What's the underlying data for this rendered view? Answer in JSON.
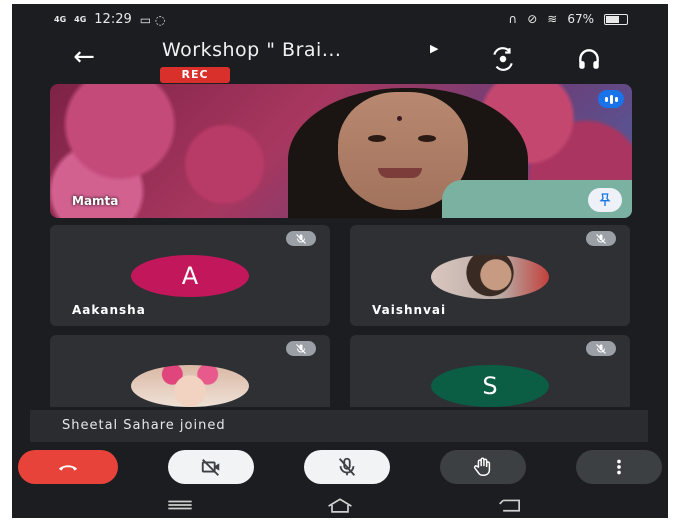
{
  "status_bar": {
    "network_left": "4G",
    "network_right": "4G",
    "time": "12:29",
    "battery": "67%"
  },
  "meeting": {
    "title": "Workshop \" Brai...",
    "recording_badge": "REC"
  },
  "main_participant": {
    "name": "Mamta"
  },
  "participants": [
    {
      "name": "Aakansha",
      "initial": "A",
      "avatar_color": "#c2185b",
      "muted": true
    },
    {
      "name": "Vaishnvai",
      "initial": "",
      "avatar_color": "",
      "muted": true
    },
    {
      "name": "",
      "initial": "",
      "avatar_color": "",
      "muted": true
    },
    {
      "name": "",
      "initial": "S",
      "avatar_color": "#0b5d43",
      "muted": true
    }
  ],
  "toast": {
    "text": "Sheetal Sahare joined"
  },
  "controls": {
    "end_call": "phone-end-icon",
    "camera": "camera-off-icon",
    "mic": "mic-off-icon",
    "raise_hand": "hand-icon",
    "more": "more-vertical-icon"
  },
  "colors": {
    "background": "#1c1d20",
    "tile": "#2e3034",
    "end_call": "#e8433a",
    "rec": "#d9302c",
    "speaking": "#1a73e8"
  }
}
